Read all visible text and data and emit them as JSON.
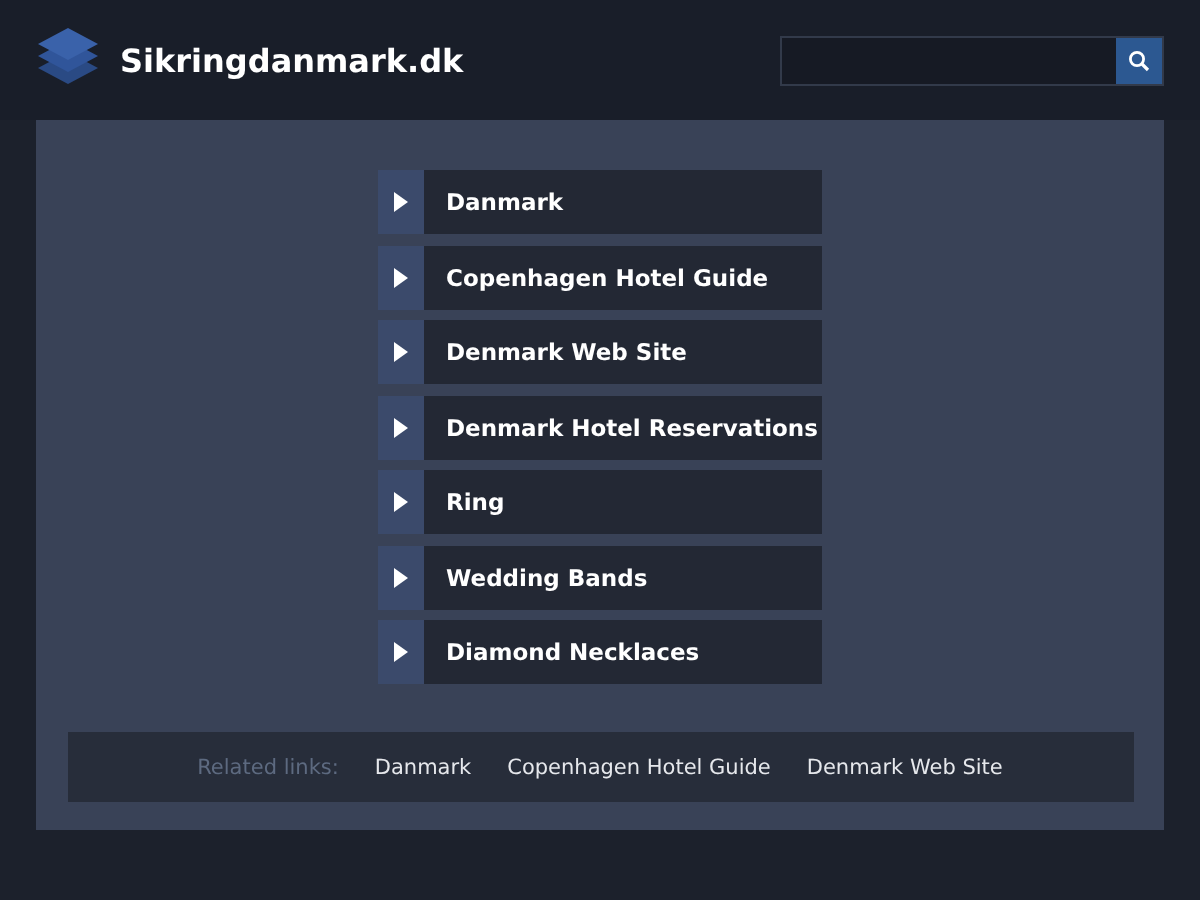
{
  "site": {
    "title": "Sikringdanmark.dk"
  },
  "links": [
    {
      "label": "Danmark"
    },
    {
      "label": "Copenhagen Hotel Guide"
    },
    {
      "label": "Denmark Web Site"
    },
    {
      "label": "Denmark Hotel Reservations"
    },
    {
      "label": "Ring"
    },
    {
      "label": "Wedding Bands"
    },
    {
      "label": "Diamond Necklaces"
    }
  ],
  "related": {
    "label": "Related links:",
    "links": [
      "Danmark",
      "Copenhagen Hotel Guide",
      "Denmark Web Site"
    ]
  }
}
